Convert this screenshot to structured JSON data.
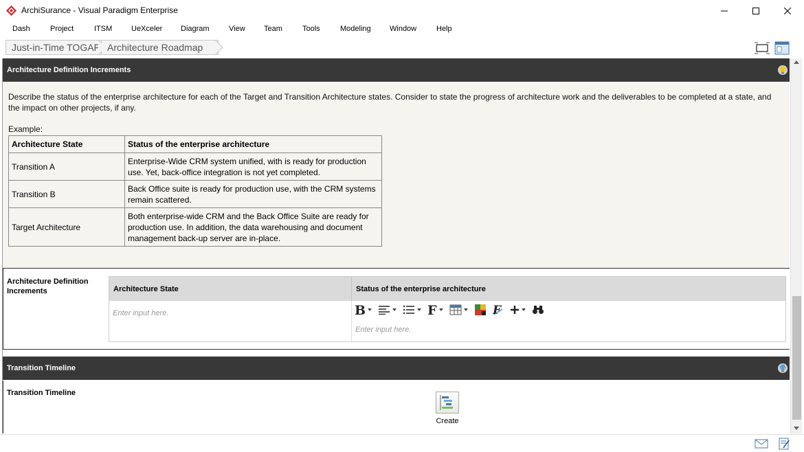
{
  "window": {
    "title": "ArchiSurance - Visual Paradigm Enterprise"
  },
  "menu": [
    "Dash",
    "Project",
    "ITSM",
    "UeXceler",
    "Diagram",
    "View",
    "Team",
    "Tools",
    "Modeling",
    "Window",
    "Help"
  ],
  "breadcrumb": [
    "Just-in-Time TOGAF",
    "Architecture Roadmap"
  ],
  "section1": {
    "title": "Architecture Definition Increments",
    "description": "Describe the status of the enterprise architecture for each of the Target and Transition Architecture states. Consider to state the progress of architecture work and the deliverables to be completed at a state, and the impact on other projects, if any.",
    "example_label": "Example:",
    "example_table": {
      "headers": [
        "Architecture State",
        "Status of the enterprise architecture"
      ],
      "rows": [
        [
          "Transition A",
          "Enterprise-Wide CRM system unified, with is ready for production use. Yet, back-office integration is not yet completed."
        ],
        [
          "Transition B",
          "Back Office suite is ready for production use, with the CRM systems remain scattered."
        ],
        [
          "Target Architecture",
          "Both enterprise-wide CRM and the Back Office Suite are ready for production use. In addition, the data warehousing and document management back-up server are in-place."
        ]
      ]
    },
    "field_label": "Architecture Definition Increments",
    "input_table": {
      "headers": [
        "Architecture State",
        "Status of the enterprise architecture"
      ],
      "placeholder": "Enter input here."
    }
  },
  "section2": {
    "title": "Transition Timeline",
    "field_label": "Transition Timeline",
    "create_label": "Create"
  },
  "colors": {
    "header_bg": "#383838",
    "description_bg": "#f5f4ef",
    "app_red": "#c8232c"
  }
}
